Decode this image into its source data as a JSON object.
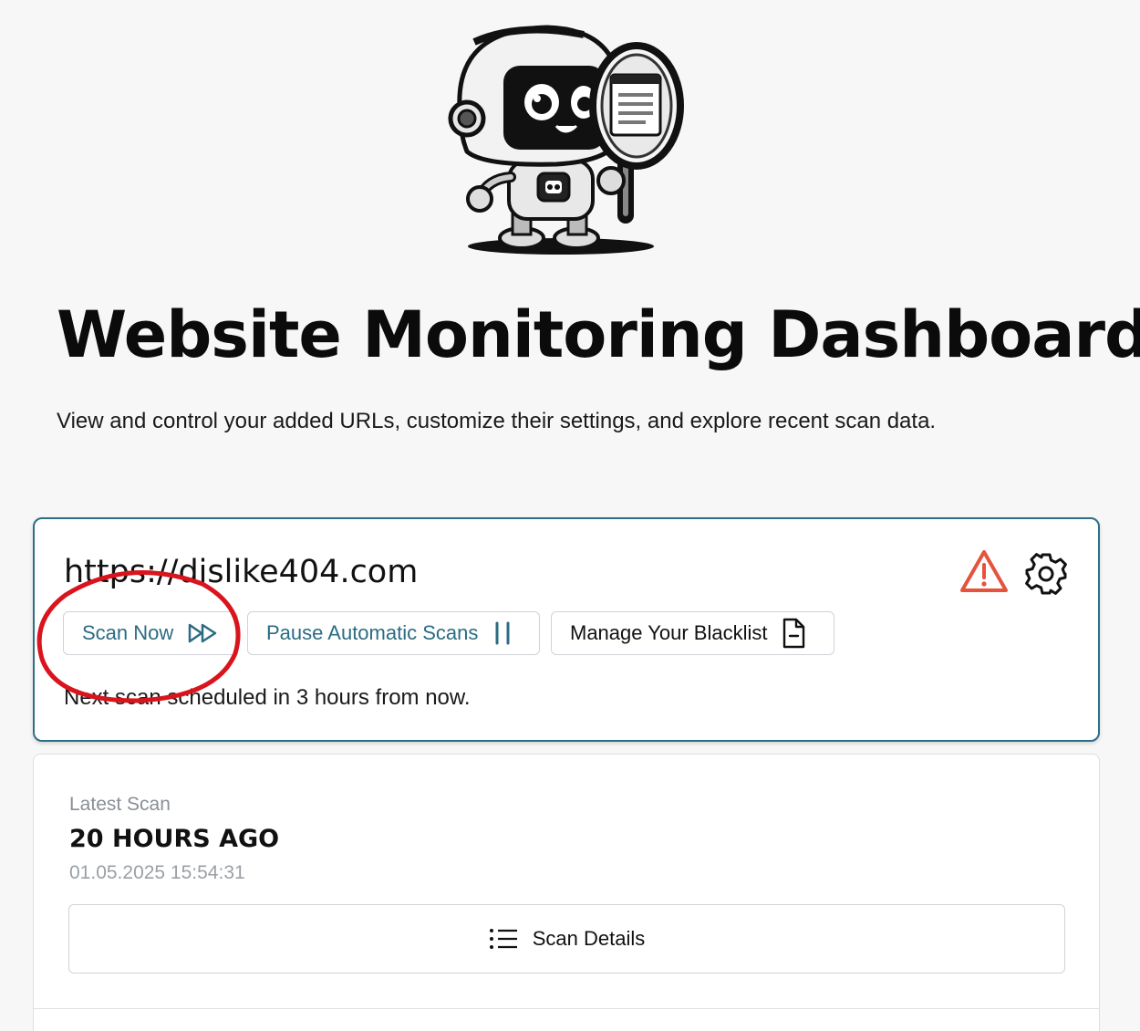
{
  "header": {
    "title": "Website Monitoring Dashboard",
    "subtitle": "View and control your added URLs, customize their settings, and explore recent scan data."
  },
  "site": {
    "url": "https://dislike404.com",
    "scan_now_label": "Scan Now",
    "pause_label": "Pause Automatic Scans",
    "blacklist_label": "Manage Your Blacklist",
    "next_scan": "Next scan scheduled in 3 hours from now.",
    "icons": {
      "warning": "warning-triangle-icon",
      "settings": "gear-icon",
      "scan": "fast-forward-icon",
      "pause": "pause-icon",
      "blacklist": "document-minus-icon"
    }
  },
  "latest_scan": {
    "label": "Latest Scan",
    "relative": "20 HOURS AGO",
    "timestamp": "01.05.2025 15:54:31",
    "details_label": "Scan Details",
    "details_icon": "list-icon"
  },
  "colors": {
    "accent": "#2b6c83",
    "warning": "#e5533d",
    "annotation": "#d9141c",
    "muted_text": "#8a8f96"
  }
}
